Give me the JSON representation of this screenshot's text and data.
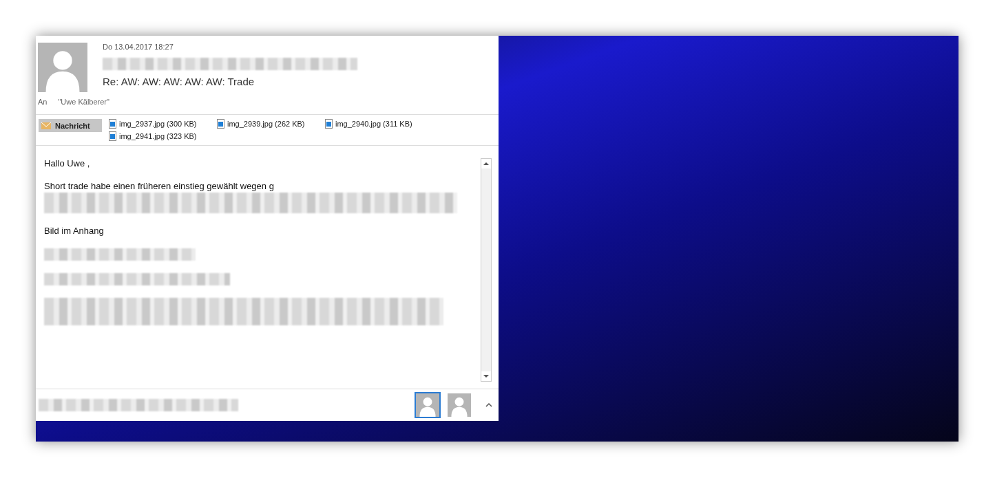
{
  "email": {
    "date": "Do 13.04.2017 18:27",
    "subject": "Re: AW: AW: AW: AW: AW: Trade",
    "to_label": "An",
    "recipient": "\"Uwe Kälberer\"",
    "message_tab": {
      "label": "Nachricht",
      "selected": true
    },
    "attachments": [
      {
        "name": "img_2937.jpg (300 KB)"
      },
      {
        "name": "img_2939.jpg (262 KB)"
      },
      {
        "name": "img_2940.jpg (311 KB)"
      },
      {
        "name": "img_2941.jpg (323 KB)"
      }
    ],
    "body": [
      {
        "kind": "text",
        "text": "Hallo Uwe ,"
      },
      {
        "kind": "text",
        "text": "Short trade habe einen früheren einstieg gewählt wegen g"
      },
      {
        "kind": "text",
        "text": "Bild im Anhang"
      }
    ],
    "people": [
      {
        "selected": true
      },
      {
        "selected": false
      }
    ]
  }
}
